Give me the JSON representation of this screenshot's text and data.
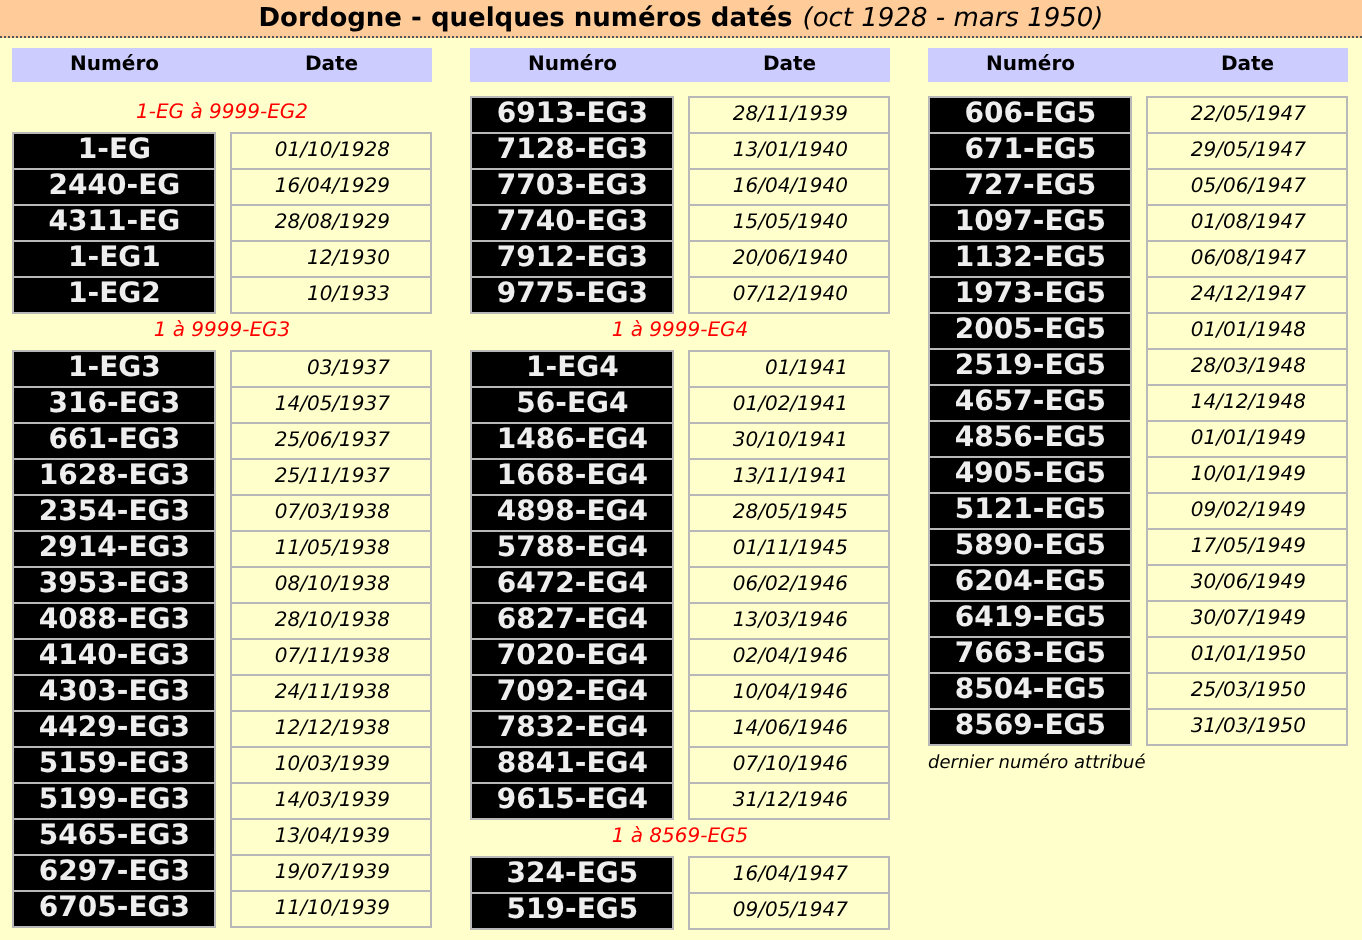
{
  "title": {
    "text": "Dordogne - quelques numéros datés",
    "subtitle": "(oct 1928 - mars 1950)"
  },
  "columns": [
    {
      "headers": [
        "Numéro",
        "Date"
      ],
      "blocks": [
        {
          "range": "1-EG à 9999-EG2",
          "rows": [
            {
              "number": "1-EG",
              "date": "01/10/1928"
            },
            {
              "number": "2440-EG",
              "date": "16/04/1929"
            },
            {
              "number": "4311-EG",
              "date": "28/08/1929"
            },
            {
              "number": "1-EG1",
              "date": "12/1930"
            },
            {
              "number": "1-EG2",
              "date": "10/1933"
            }
          ]
        },
        {
          "range": "1 à 9999-EG3",
          "rows": [
            {
              "number": "1-EG3",
              "date": "03/1937"
            },
            {
              "number": "316-EG3",
              "date": "14/05/1937"
            },
            {
              "number": "661-EG3",
              "date": "25/06/1937"
            },
            {
              "number": "1628-EG3",
              "date": "25/11/1937"
            },
            {
              "number": "2354-EG3",
              "date": "07/03/1938"
            },
            {
              "number": "2914-EG3",
              "date": "11/05/1938"
            },
            {
              "number": "3953-EG3",
              "date": "08/10/1938"
            },
            {
              "number": "4088-EG3",
              "date": "28/10/1938"
            },
            {
              "number": "4140-EG3",
              "date": "07/11/1938"
            },
            {
              "number": "4303-EG3",
              "date": "24/11/1938"
            },
            {
              "number": "4429-EG3",
              "date": "12/12/1938"
            },
            {
              "number": "5159-EG3",
              "date": "10/03/1939"
            },
            {
              "number": "5199-EG3",
              "date": "14/03/1939"
            },
            {
              "number": "5465-EG3",
              "date": "13/04/1939"
            },
            {
              "number": "6297-EG3",
              "date": "19/07/1939"
            },
            {
              "number": "6705-EG3",
              "date": "11/10/1939"
            }
          ]
        }
      ]
    },
    {
      "headers": [
        "Numéro",
        "Date"
      ],
      "blocks": [
        {
          "rows": [
            {
              "number": "6913-EG3",
              "date": "28/11/1939"
            },
            {
              "number": "7128-EG3",
              "date": "13/01/1940"
            },
            {
              "number": "7703-EG3",
              "date": "16/04/1940"
            },
            {
              "number": "7740-EG3",
              "date": "15/05/1940"
            },
            {
              "number": "7912-EG3",
              "date": "20/06/1940"
            },
            {
              "number": "9775-EG3",
              "date": "07/12/1940"
            }
          ]
        },
        {
          "range": "1 à 9999-EG4",
          "rows": [
            {
              "number": "1-EG4",
              "date": "01/1941"
            },
            {
              "number": "56-EG4",
              "date": "01/02/1941"
            },
            {
              "number": "1486-EG4",
              "date": "30/10/1941"
            },
            {
              "number": "1668-EG4",
              "date": "13/11/1941"
            },
            {
              "number": "4898-EG4",
              "date": "28/05/1945"
            },
            {
              "number": "5788-EG4",
              "date": "01/11/1945"
            },
            {
              "number": "6472-EG4",
              "date": "06/02/1946"
            },
            {
              "number": "6827-EG4",
              "date": "13/03/1946"
            },
            {
              "number": "7020-EG4",
              "date": "02/04/1946"
            },
            {
              "number": "7092-EG4",
              "date": "10/04/1946"
            },
            {
              "number": "7832-EG4",
              "date": "14/06/1946"
            },
            {
              "number": "8841-EG4",
              "date": "07/10/1946"
            },
            {
              "number": "9615-EG4",
              "date": "31/12/1946"
            }
          ]
        },
        {
          "range": "1 à 8569-EG5",
          "rows": [
            {
              "number": "324-EG5",
              "date": "16/04/1947"
            },
            {
              "number": "519-EG5",
              "date": "09/05/1947"
            }
          ]
        }
      ]
    },
    {
      "headers": [
        "Numéro",
        "Date"
      ],
      "blocks": [
        {
          "rows": [
            {
              "number": "606-EG5",
              "date": "22/05/1947"
            },
            {
              "number": "671-EG5",
              "date": "29/05/1947"
            },
            {
              "number": "727-EG5",
              "date": "05/06/1947"
            },
            {
              "number": "1097-EG5",
              "date": "01/08/1947"
            },
            {
              "number": "1132-EG5",
              "date": "06/08/1947"
            },
            {
              "number": "1973-EG5",
              "date": "24/12/1947"
            },
            {
              "number": "2005-EG5",
              "date": "01/01/1948"
            },
            {
              "number": "2519-EG5",
              "date": "28/03/1948"
            },
            {
              "number": "4657-EG5",
              "date": "14/12/1948"
            },
            {
              "number": "4856-EG5",
              "date": "01/01/1949"
            },
            {
              "number": "4905-EG5",
              "date": "10/01/1949"
            },
            {
              "number": "5121-EG5",
              "date": "09/02/1949"
            },
            {
              "number": "5890-EG5",
              "date": "17/05/1949"
            },
            {
              "number": "6204-EG5",
              "date": "30/06/1949"
            },
            {
              "number": "6419-EG5",
              "date": "30/07/1949"
            },
            {
              "number": "7663-EG5",
              "date": "01/01/1950"
            },
            {
              "number": "8504-EG5",
              "date": "25/03/1950"
            },
            {
              "number": "8569-EG5",
              "date": "31/03/1950"
            }
          ]
        }
      ],
      "note": "dernier numéro attribué"
    }
  ]
}
